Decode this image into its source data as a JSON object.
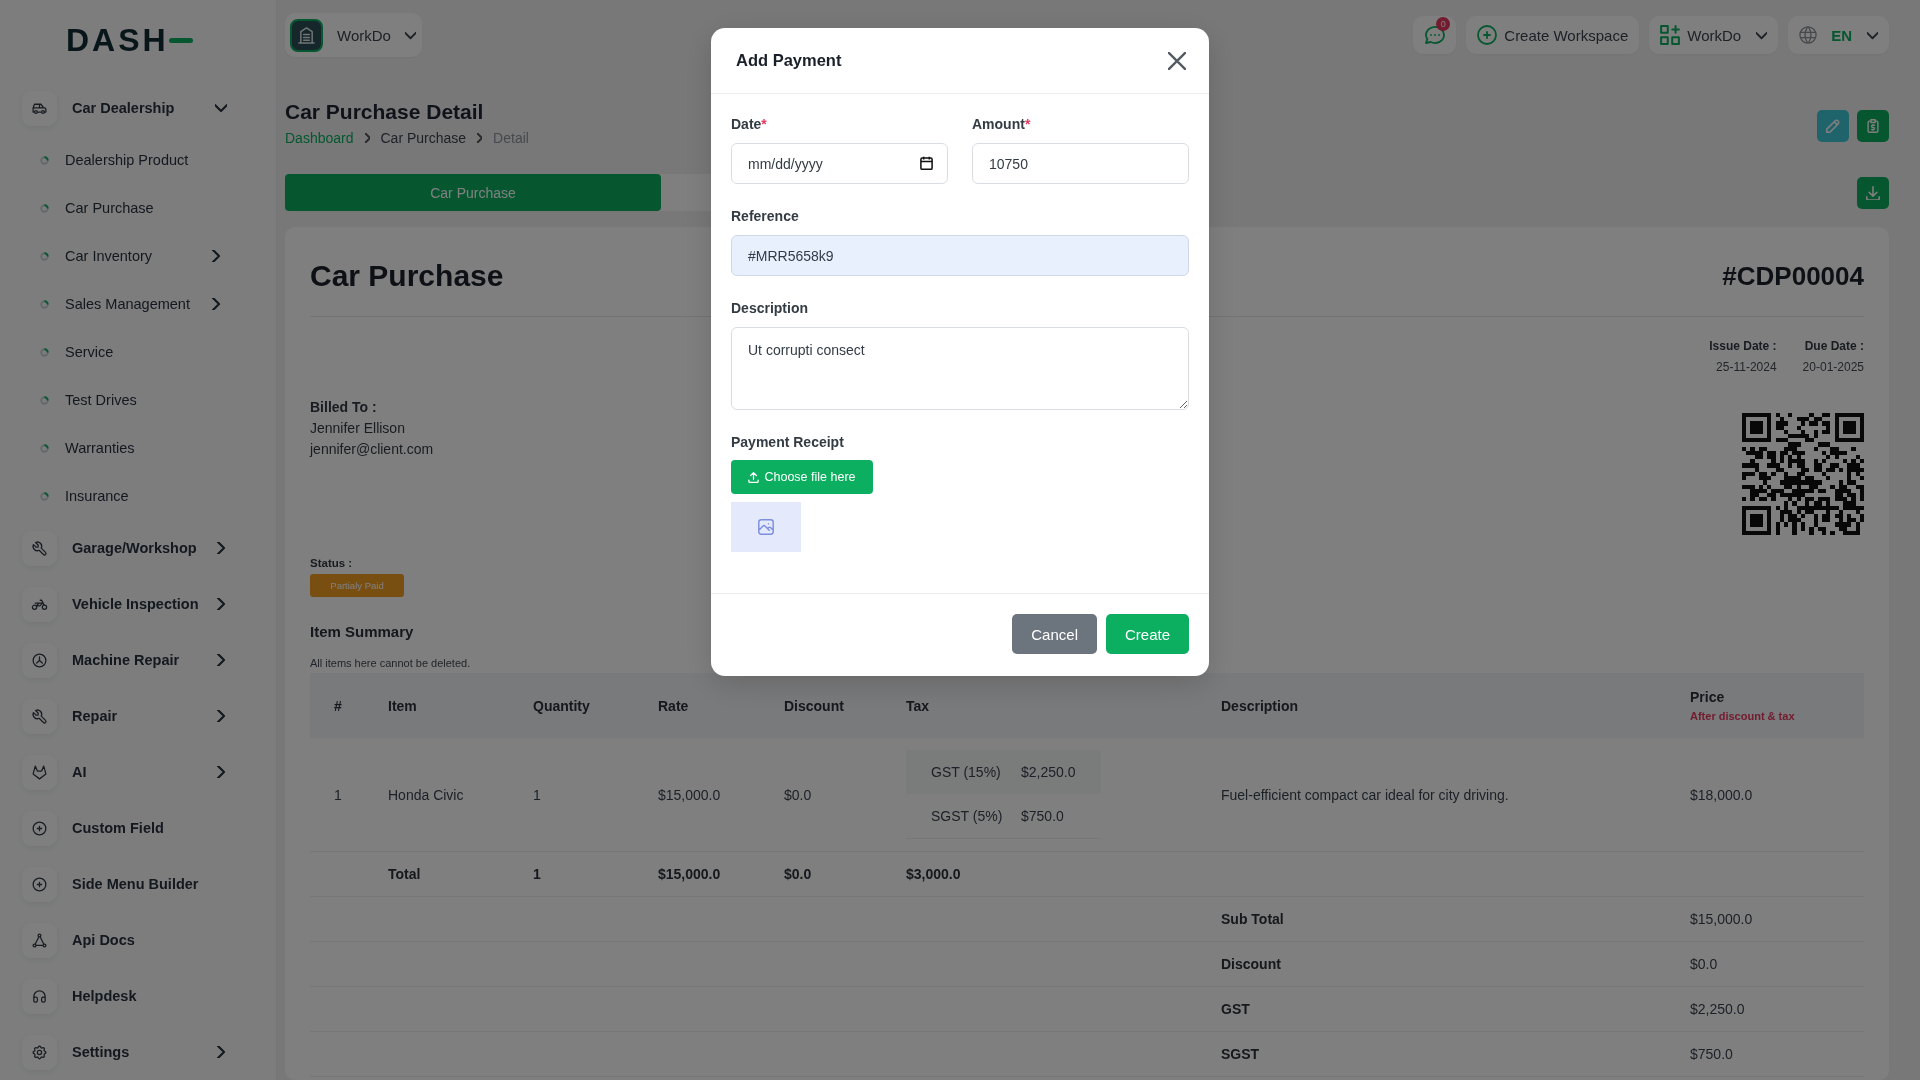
{
  "brand": "DASH",
  "sidebar": {
    "items": [
      {
        "label": "Car Dealership",
        "kind": "menu",
        "expanded": true,
        "children": [
          {
            "label": "Dealership Product",
            "kind": "link"
          },
          {
            "label": "Car Purchase",
            "kind": "link"
          },
          {
            "label": "Car Inventory",
            "kind": "menu",
            "expanded": false
          },
          {
            "label": "Sales Management",
            "kind": "menu",
            "expanded": false
          },
          {
            "label": "Service",
            "kind": "link"
          },
          {
            "label": "Test Drives",
            "kind": "link"
          },
          {
            "label": "Warranties",
            "kind": "link"
          },
          {
            "label": "Insurance",
            "kind": "link"
          }
        ]
      },
      {
        "label": "Garage/Workshop",
        "kind": "menu",
        "expanded": false
      },
      {
        "label": "Vehicle Inspection",
        "kind": "menu",
        "expanded": false
      },
      {
        "label": "Machine Repair",
        "kind": "menu",
        "expanded": false
      },
      {
        "label": "Repair",
        "kind": "menu",
        "expanded": false
      },
      {
        "label": "AI",
        "kind": "menu",
        "expanded": false
      },
      {
        "label": "Custom Field",
        "kind": "link"
      },
      {
        "label": "Side Menu Builder",
        "kind": "link"
      },
      {
        "label": "Api Docs",
        "kind": "link"
      },
      {
        "label": "Helpdesk",
        "kind": "link"
      },
      {
        "label": "Settings",
        "kind": "menu",
        "expanded": false
      }
    ]
  },
  "topbar": {
    "workspace": "WorkDo",
    "messages_badge": "0",
    "create_workspace": "Create Workspace",
    "workspace_menu": "WorkDo",
    "language": "EN"
  },
  "page": {
    "title": "Car Purchase Detail",
    "breadcrumb": [
      {
        "label": "Dashboard",
        "kind": "link"
      },
      {
        "label": "Car Purchase",
        "kind": "text"
      },
      {
        "label": "Detail",
        "kind": "current"
      }
    ]
  },
  "tabs": [
    {
      "label": "Car Purchase",
      "selected": true
    }
  ],
  "invoice": {
    "title": "Car Purchase",
    "number": "#CDP00004",
    "dates": [
      {
        "label": "Issue Date :",
        "value": "25-11-2024"
      },
      {
        "label": "Due Date :",
        "value": "20-01-2025"
      }
    ],
    "billed_to": {
      "label": "Billed To :",
      "lines": [
        "Jennifer Ellison",
        "jennifer@client.com"
      ]
    },
    "status": {
      "label": "Status :",
      "value": "Partialy Paid"
    }
  },
  "item_summary": {
    "title": "Item Summary",
    "note": "All items here cannot be deleted.",
    "columns": [
      {
        "label": "#"
      },
      {
        "label": "Item"
      },
      {
        "label": "Quantity"
      },
      {
        "label": "Rate"
      },
      {
        "label": "Discount"
      },
      {
        "label": "Tax"
      },
      {
        "label": "Description"
      },
      {
        "label": "Price",
        "note": "After discount & tax"
      }
    ],
    "rows": [
      {
        "cells": [
          "1",
          "Honda Civic",
          "1",
          "$15,000.0",
          "$0.0"
        ],
        "taxes": [
          {
            "name": "GST (15%)",
            "amount": "$2,250.0"
          },
          {
            "name": "SGST (5%)",
            "amount": "$750.0"
          }
        ],
        "description": "Fuel-efficient compact car ideal for city driving.",
        "price": "$18,000.0"
      }
    ],
    "total": {
      "label": "Total",
      "quantity": "1",
      "rate": "$15,000.0",
      "discount": "$0.0",
      "tax": "$3,000.0"
    },
    "summary": [
      {
        "label": "Sub Total",
        "value": "$15,000.0"
      },
      {
        "label": "Discount",
        "value": "$0.0"
      },
      {
        "label": "GST",
        "value": "$2,250.0"
      },
      {
        "label": "SGST",
        "value": "$750.0"
      }
    ]
  },
  "modal": {
    "title": "Add Payment",
    "rows": [
      [
        {
          "label": "Date",
          "required_mark": "*",
          "kind": "date",
          "placeholder": "mm/dd/yyyy",
          "autofilled": false
        },
        {
          "label": "Amount",
          "required_mark": "*",
          "kind": "text",
          "value": "10750",
          "autofilled": false
        }
      ],
      [
        {
          "label": "Reference",
          "kind": "text",
          "value": "#MRR5658k9",
          "autofilled": true
        }
      ],
      [
        {
          "label": "Description",
          "kind": "textarea",
          "value": "Ut corrupti consect",
          "autofilled": false
        }
      ]
    ],
    "receipt": {
      "label": "Payment Receipt",
      "button": "Choose file here"
    },
    "buttons": [
      {
        "label": "Cancel",
        "kind": "secondary"
      },
      {
        "label": "Create",
        "kind": "primary"
      }
    ]
  }
}
